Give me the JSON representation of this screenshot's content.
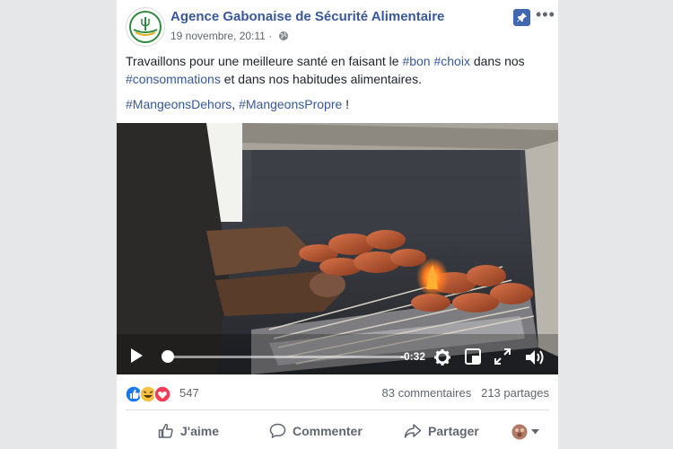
{
  "post": {
    "page_name": "Agence Gabonaise de Sécurité Alimentaire",
    "timestamp": "19 novembre, 20:11",
    "text_a": "Travaillons pour une meilleure santé en faisant le ",
    "tag_bon": "#bon",
    "tag_choix": "#choix",
    "text_b": " dans nos ",
    "tag_conso": "#consommations",
    "text_c": " et dans nos habitudes alimentaires.",
    "tag_dehors": "#MangeonsDehors",
    "sep": ", ",
    "tag_propre": "#MangeonsPropre",
    "end": " !"
  },
  "video": {
    "time_remaining": "-0:32",
    "progress": 0.04
  },
  "stats": {
    "reactions_count": "547",
    "comments": "83 commentaires",
    "shares": "213 partages"
  },
  "actions": {
    "like": "J'aime",
    "comment": "Commenter",
    "share": "Partager"
  },
  "icons": {
    "pin": "pin-icon",
    "globe": "globe-icon",
    "play": "play-icon",
    "settings": "gear-icon",
    "fullscreen": "expand-icon",
    "volume": "volume-icon"
  },
  "colors": {
    "brand": "#385898",
    "accent": "#4267b2"
  }
}
